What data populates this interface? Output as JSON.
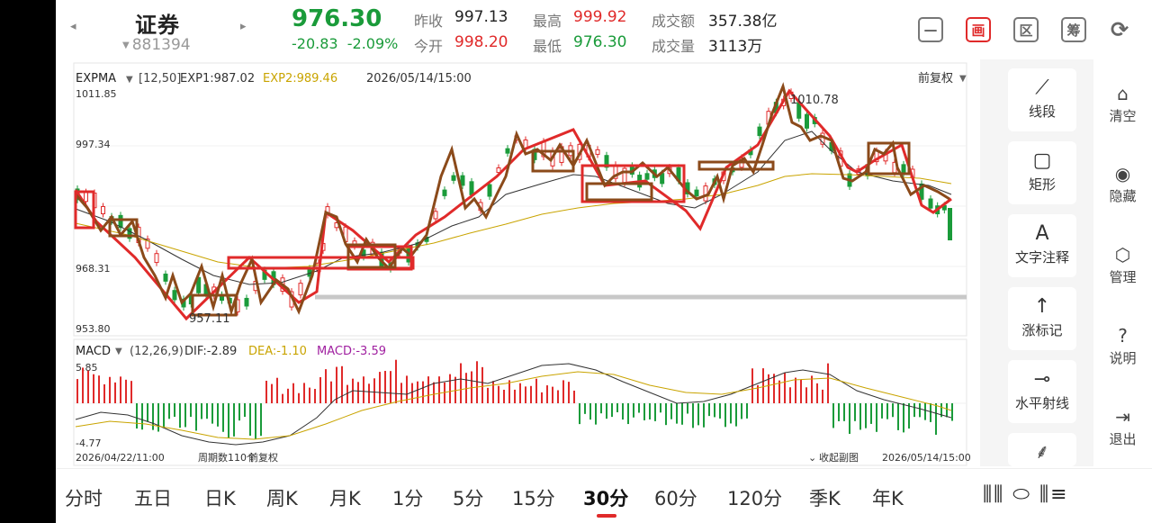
{
  "header": {
    "name": "证券",
    "code": "881394",
    "price": "976.30",
    "change": "-20.83",
    "change_pct": "-2.09%",
    "stats": [
      {
        "label": "昨收",
        "value": "997.13",
        "color": "#222222"
      },
      {
        "label": "今开",
        "value": "998.20",
        "color": "#e02a2a"
      },
      {
        "label": "最高",
        "value": "999.92",
        "color": "#e02a2a"
      },
      {
        "label": "最低",
        "value": "976.30",
        "color": "#1a9b3a"
      },
      {
        "label": "成交额",
        "value": "357.38亿",
        "color": "#222222"
      },
      {
        "label": "成交量",
        "value": "3113万",
        "color": "#222222"
      }
    ],
    "icons": [
      {
        "name": "minimize-icon",
        "glyph": "—"
      },
      {
        "name": "draw-icon",
        "glyph": "画"
      },
      {
        "name": "range-icon",
        "glyph": "区"
      },
      {
        "name": "chips-icon",
        "glyph": "筹"
      },
      {
        "name": "rotate-screen-icon",
        "glyph": "⟳"
      }
    ]
  },
  "chart": {
    "indicator": "EXPMA",
    "params": "[12,50]",
    "exp1": "EXP1:987.02",
    "exp2": "EXP2:989.46",
    "datetime": "2026/05/14/15:00",
    "adjust": "前复权",
    "y_labels": [
      "1011.85",
      "997.34",
      "968.31",
      "953.80"
    ],
    "high_label": "1010.78",
    "low_label": "957.11",
    "macd_name": "MACD",
    "macd_params": "(12,26,9)",
    "dif": "DIF:-2.89",
    "dea": "DEA:-1.10",
    "macd": "MACD:-3.59",
    "macd_top": "5.85",
    "macd_bottom": "-4.77",
    "start_time": "2026/04/22/11:00",
    "period_count": "周期数110个",
    "adjust_footer": "前复权",
    "collapse_sub": "收起副图",
    "end_time": "2026/05/14/15:00",
    "colors": {
      "up": "#e02a2a",
      "down": "#1a9b3a",
      "exp1": "#333333",
      "exp2": "#c9a400",
      "wave_line": "#e02a2a",
      "box_red": "#e02a2a",
      "box_brown": "#8b4a1a"
    }
  },
  "draw_tools": [
    {
      "name": "line-segment-tool",
      "icon": "⟋",
      "label": "线段"
    },
    {
      "name": "rectangle-tool",
      "icon": "▢",
      "label": "矩形"
    },
    {
      "name": "text-note-tool",
      "icon": "A",
      "label": "文字注释"
    },
    {
      "name": "up-mark-tool",
      "icon": "↑",
      "label": "涨标记"
    },
    {
      "name": "horizontal-ray-tool",
      "icon": "⊸",
      "label": "水平射线"
    },
    {
      "name": "more-tool",
      "icon": "⸙",
      "label": ""
    }
  ],
  "side_menu": [
    {
      "name": "clear",
      "icon": "⌂",
      "label": "清空"
    },
    {
      "name": "hide",
      "icon": "◉",
      "label": "隐藏"
    },
    {
      "name": "manage",
      "icon": "⬡",
      "label": "管理"
    },
    {
      "name": "help",
      "icon": "?",
      "label": "说明"
    },
    {
      "name": "exit",
      "icon": "⇥",
      "label": "退出"
    }
  ],
  "periods": [
    "分时",
    "五日",
    "日K",
    "周K",
    "月K",
    "1分",
    "5分",
    "15分",
    "30分",
    "60分",
    "120分",
    "季K",
    "年K"
  ],
  "active_period": "30分",
  "bottom_icons": "⫼⫼ ⬭ ⫼≡"
}
